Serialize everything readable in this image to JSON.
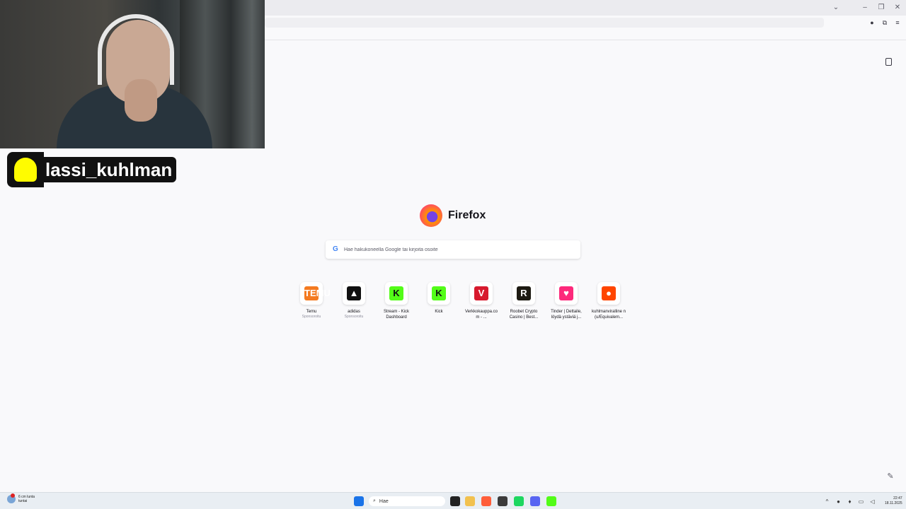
{
  "browser": {
    "window_controls": {
      "list_tabs": "⌄",
      "minimize": "–",
      "restore": "❐",
      "close": "✕"
    }
  },
  "overlay": {
    "snapchat_username": "lassi_kuhlman"
  },
  "newtab": {
    "brand_name": "Firefox",
    "search_placeholder": "Hae hakukoneella Google tai kirjoita osoite",
    "search_engine_icon": "G",
    "shortcuts": [
      {
        "label": "Temu",
        "sub": "Sponsoroitu",
        "icon": "TEMU",
        "color": "#f47a20"
      },
      {
        "label": "adidas",
        "sub": "Sponsoroitu",
        "icon": "▲",
        "color": "#111111"
      },
      {
        "label": "Stream - Kick Dashboard",
        "sub": "",
        "icon": "K",
        "color": "#53fc18"
      },
      {
        "label": "Kick",
        "sub": "",
        "icon": "K",
        "color": "#53fc18"
      },
      {
        "label": "Verkkokauppa.co m - ...",
        "sub": "",
        "icon": "V",
        "color": "#d7192d"
      },
      {
        "label": "Roobet Crypto Casino | Best...",
        "sub": "",
        "icon": "R",
        "color": "#1d1a12"
      },
      {
        "label": "Tinder | Dettaile, löydä ystäviä j...",
        "sub": "",
        "icon": "♥",
        "color": "#fd297b"
      },
      {
        "label": "kuhlmanviralline n (u/Equivalem...",
        "sub": "",
        "icon": "●",
        "color": "#ff4500"
      }
    ]
  },
  "taskbar": {
    "weather_line1": "6 cm lunta",
    "weather_line2": "tuntai",
    "search_label": "Hae",
    "time": "22:47",
    "date": "18.11.2025",
    "apps": [
      {
        "name": "file-explorer-icon",
        "color": "#f2c14e"
      },
      {
        "name": "firefox-taskbar-icon",
        "color": "#ff5e3a"
      },
      {
        "name": "obs-icon",
        "color": "#3b3b3b"
      },
      {
        "name": "spotify-icon",
        "color": "#1ed760"
      },
      {
        "name": "discord-icon",
        "color": "#5865f2"
      },
      {
        "name": "kick-taskbar-icon",
        "color": "#53fc18"
      }
    ]
  }
}
